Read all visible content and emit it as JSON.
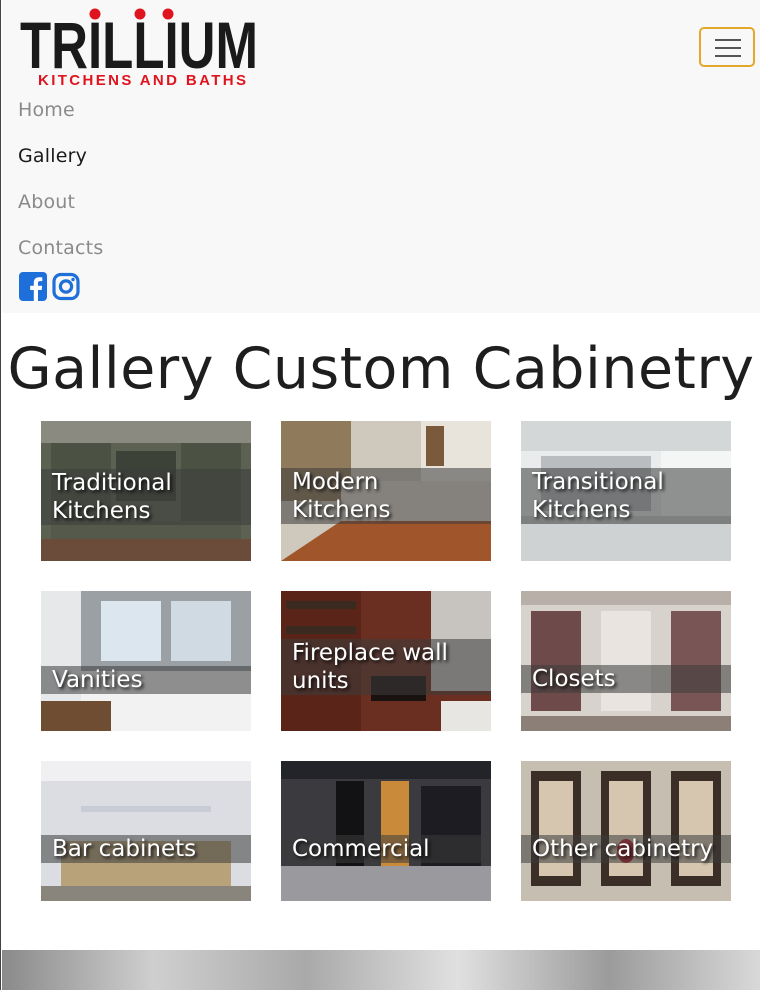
{
  "brand": {
    "name": "TRILLIUM",
    "tagline": "KITCHENS AND BATHS",
    "name_color": "#1a1a1a",
    "tagline_color": "#e0141e",
    "dot_color": "#e0141e"
  },
  "nav": {
    "toggle_icon": "hamburger-icon",
    "toggle_border_color": "#e3a82a",
    "items": [
      {
        "label": "Home",
        "active": false
      },
      {
        "label": "Gallery",
        "active": true
      },
      {
        "label": "About",
        "active": false
      },
      {
        "label": "Contacts",
        "active": false
      }
    ],
    "social": [
      {
        "icon": "facebook-icon",
        "color": "#1e6fd9"
      },
      {
        "icon": "instagram-icon",
        "color": "#1e6fd9"
      }
    ]
  },
  "page": {
    "title": "Gallery Custom Cabinetry"
  },
  "gallery": [
    {
      "line1": "Traditional",
      "line2": "Kitchens"
    },
    {
      "line1": "Modern",
      "line2": "Kitchens"
    },
    {
      "line1": "Transitional",
      "line2": "Kitchens"
    },
    {
      "line1": "Vanities",
      "line2": ""
    },
    {
      "line1": "Fireplace wall",
      "line2": "units"
    },
    {
      "line1": "Closets",
      "line2": ""
    },
    {
      "line1": "Bar cabinets",
      "line2": ""
    },
    {
      "line1": "Commercial",
      "line2": ""
    },
    {
      "line1": "Other cabinetry",
      "line2": ""
    }
  ]
}
